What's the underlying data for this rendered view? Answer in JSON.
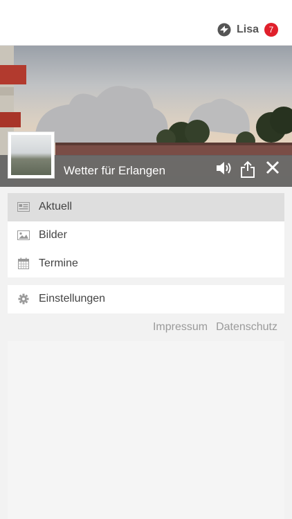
{
  "header": {
    "user_name": "Lisa",
    "notification_count": "7"
  },
  "hero": {
    "title": "Wetter für Erlangen"
  },
  "menu": {
    "items": [
      {
        "label": "Aktuell",
        "icon": "newspaper-icon",
        "active": true
      },
      {
        "label": "Bilder",
        "icon": "image-icon",
        "active": false
      },
      {
        "label": "Termine",
        "icon": "calendar-icon",
        "active": false
      }
    ],
    "settings_label": "Einstellungen"
  },
  "footer": {
    "impressum": "Impressum",
    "datenschutz": "Datenschutz"
  },
  "colors": {
    "badge": "#e0202b",
    "accent_bar": "#626262"
  }
}
